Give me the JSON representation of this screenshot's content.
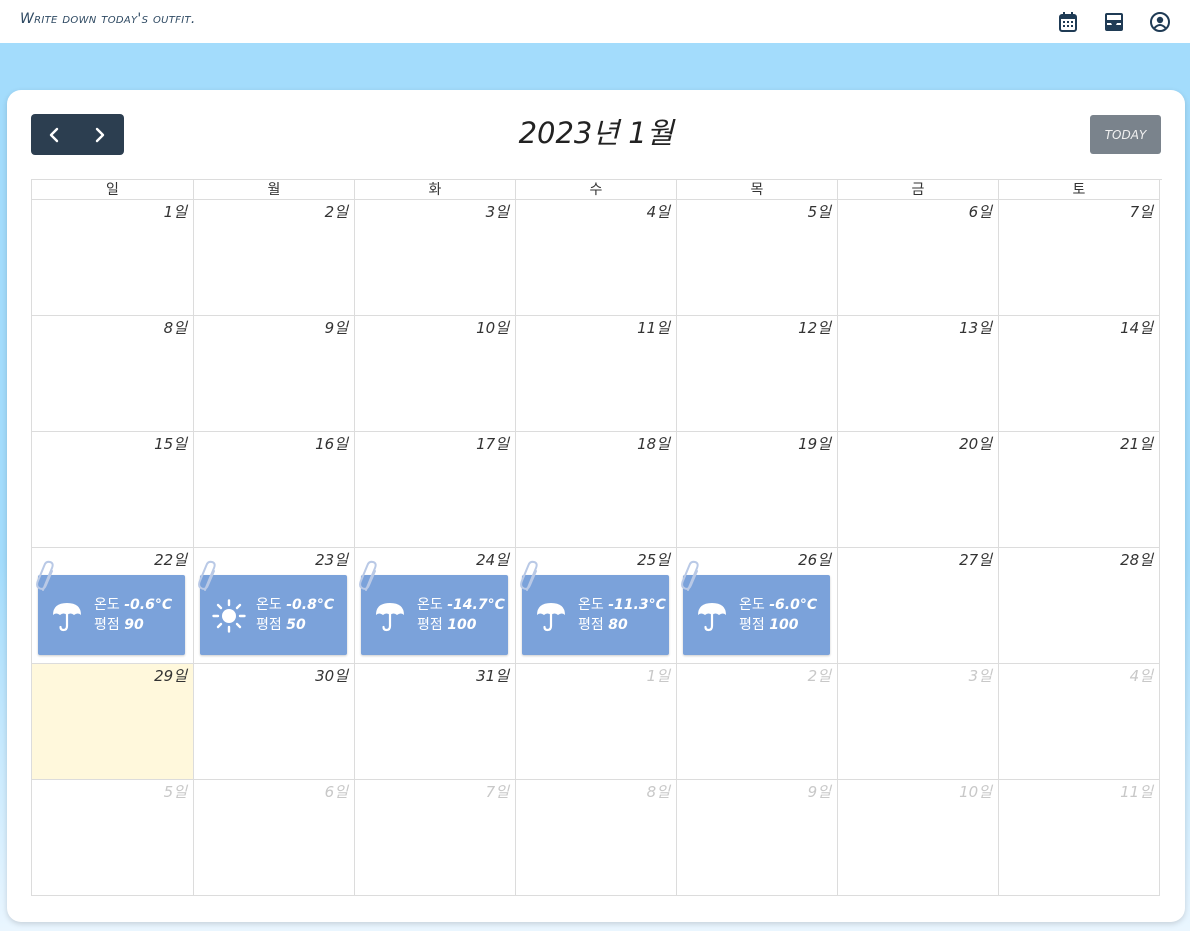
{
  "app": {
    "title": "Write down today's outfit."
  },
  "header_icons": [
    "calendar-icon",
    "inbox-icon",
    "user-circle-icon"
  ],
  "calendar": {
    "title": "2023년 1월",
    "today_label": "TODAY",
    "weekdays": [
      "일",
      "월",
      "화",
      "수",
      "목",
      "금",
      "토"
    ],
    "weeks": [
      [
        {
          "label": "1일"
        },
        {
          "label": "2일"
        },
        {
          "label": "3일"
        },
        {
          "label": "4일"
        },
        {
          "label": "5일"
        },
        {
          "label": "6일"
        },
        {
          "label": "7일"
        }
      ],
      [
        {
          "label": "8일"
        },
        {
          "label": "9일"
        },
        {
          "label": "10일"
        },
        {
          "label": "11일"
        },
        {
          "label": "12일"
        },
        {
          "label": "13일"
        },
        {
          "label": "14일"
        }
      ],
      [
        {
          "label": "15일"
        },
        {
          "label": "16일"
        },
        {
          "label": "17일"
        },
        {
          "label": "18일"
        },
        {
          "label": "19일"
        },
        {
          "label": "20일"
        },
        {
          "label": "21일"
        }
      ],
      [
        {
          "label": "22일",
          "event": {
            "weather": "umbrella",
            "temp": "-0.6°C",
            "score": "90"
          }
        },
        {
          "label": "23일",
          "event": {
            "weather": "sun",
            "temp": "-0.8°C",
            "score": "50"
          }
        },
        {
          "label": "24일",
          "event": {
            "weather": "umbrella",
            "temp": "-14.7°C",
            "score": "100"
          }
        },
        {
          "label": "25일",
          "event": {
            "weather": "umbrella",
            "temp": "-11.3°C",
            "score": "80"
          }
        },
        {
          "label": "26일",
          "event": {
            "weather": "umbrella",
            "temp": "-6.0°C",
            "score": "100"
          }
        },
        {
          "label": "27일"
        },
        {
          "label": "28일"
        }
      ],
      [
        {
          "label": "29일",
          "today": true
        },
        {
          "label": "30일"
        },
        {
          "label": "31일"
        },
        {
          "label": "1일",
          "other": true
        },
        {
          "label": "2일",
          "other": true
        },
        {
          "label": "3일",
          "other": true
        },
        {
          "label": "4일",
          "other": true
        }
      ],
      [
        {
          "label": "5일",
          "other": true
        },
        {
          "label": "6일",
          "other": true
        },
        {
          "label": "7일",
          "other": true
        },
        {
          "label": "8일",
          "other": true
        },
        {
          "label": "9일",
          "other": true
        },
        {
          "label": "10일",
          "other": true
        },
        {
          "label": "11일",
          "other": true
        }
      ]
    ],
    "event_labels": {
      "temp": "온도",
      "score": "평점"
    }
  },
  "colors": {
    "nav_bg": "#2c3e50",
    "event_bg": "#7ba2da",
    "today_bg": "#fff8dc",
    "header_icon": "#1f3b55"
  }
}
